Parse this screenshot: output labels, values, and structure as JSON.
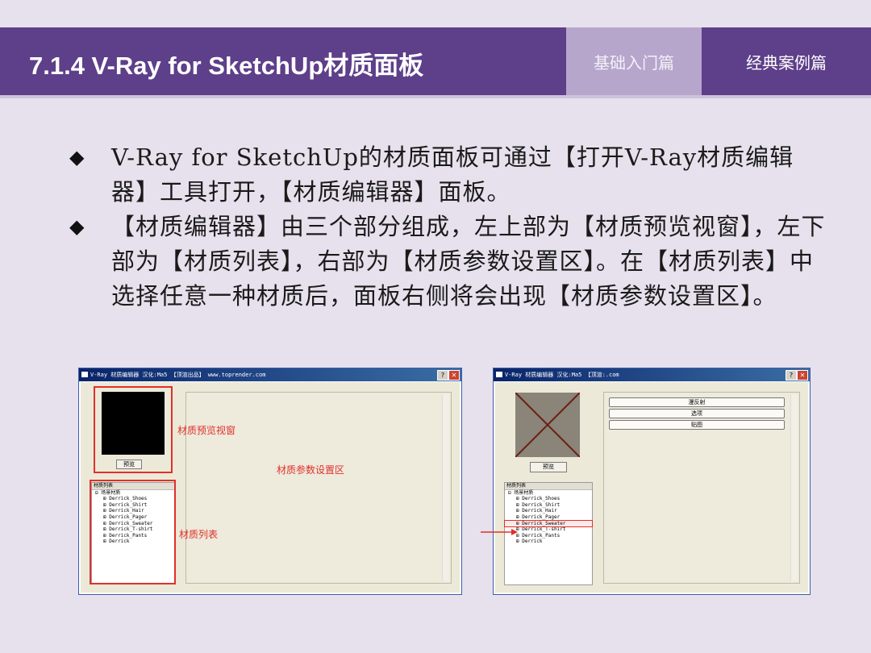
{
  "header": {
    "title": "7.1.4  V-Ray for SketchUp材质面板",
    "tab_basic": "基础入门篇",
    "tab_classic": "经典案例篇"
  },
  "bullets": [
    "V-Ray for SketchUp的材质面板可通过【打开V-Ray材质编辑器】工具打开，【材质编辑器】面板。",
    "【材质编辑器】由三个部分组成，左上部为【材质预览视窗】，左下部为【材质列表】，右部为【材质参数设置区】。在【材质列表】中选择任意一种材质后，面板右侧将会出现【材质参数设置区】。"
  ],
  "bullet_mark": "◆",
  "left_shot": {
    "title": "V-Ray 材质编辑器    汉化:Ma5    【顶渲出品】 www.toprender.com",
    "help": "?",
    "close": "✕",
    "preview_button": "预览",
    "tree_header": "材质列表",
    "tree_root": "场景材质",
    "materials": [
      "Derrick_Shoes",
      "Derrick_Shirt",
      "Derrick_Hair",
      "Derrick_Pager",
      "Derrick_Sweater",
      "Derrick_T-shirt",
      "Derrick_Pants",
      "Derrick"
    ],
    "label_preview": "材质预览视窗",
    "label_params": "材质参数设置区",
    "label_list": "材质列表"
  },
  "right_shot": {
    "title": "V-Ray 材质编辑器    汉化:Ma5    【顶渲:.com",
    "help": "?",
    "close": "✕",
    "preview_button": "预览",
    "tree_header": "材质列表",
    "tree_root": "场景材质",
    "materials": [
      "Derrick_Shoes",
      "Derrick_Shirt",
      "Derrick_Hair",
      "Derrick_Pager",
      "Derrick_Sweater",
      "Derrick_T-shirt",
      "Derrick_Pants",
      "Derrick"
    ],
    "selected_index": 4,
    "param_buttons": [
      "漫反射",
      "选项",
      "贴图"
    ]
  },
  "colors": {
    "title_bar": "#5e3f8a",
    "tab_basic": "#b7a6cc",
    "background": "#e6e1ec",
    "annotation_red": "#e0302a"
  }
}
